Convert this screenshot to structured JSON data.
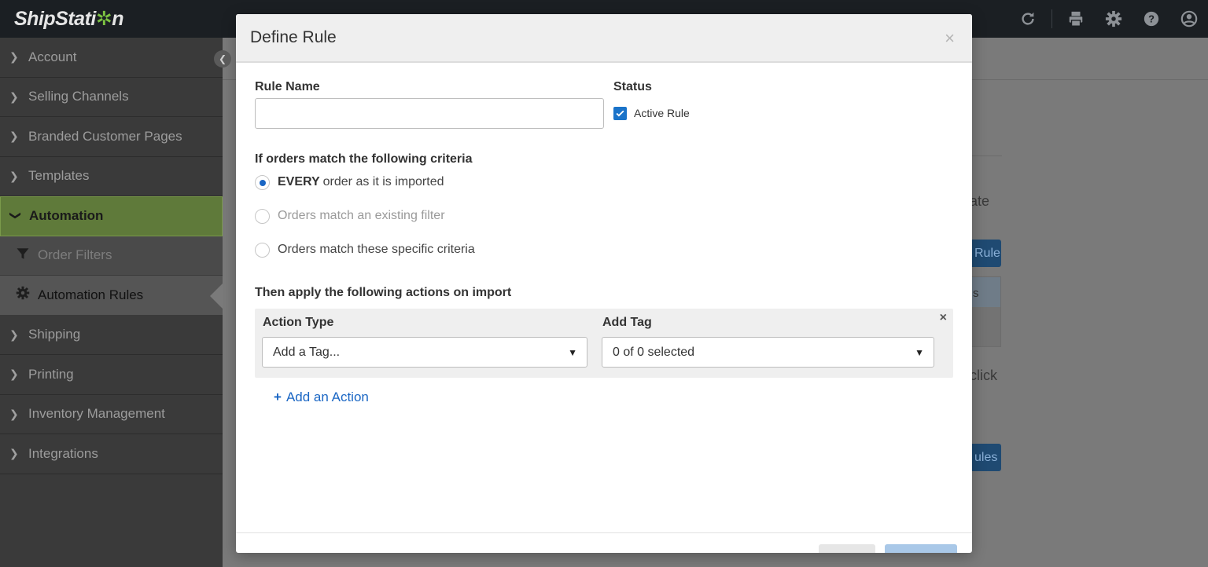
{
  "app": {
    "logo_left": "ShipStati",
    "logo_gear": "✲",
    "logo_right": "n"
  },
  "topbar": {
    "icons": [
      "refresh-icon",
      "printer-icon",
      "gear-icon",
      "help-icon",
      "user-icon"
    ]
  },
  "sidebar": {
    "items": [
      {
        "label": "Account"
      },
      {
        "label": "Selling Channels"
      },
      {
        "label": "Branded Customer Pages"
      },
      {
        "label": "Templates"
      },
      {
        "label": "Automation"
      },
      {
        "label": "Order Filters"
      },
      {
        "label": "Automation Rules"
      },
      {
        "label": "Shipping"
      },
      {
        "label": "Printing"
      },
      {
        "label": "Inventory Management"
      },
      {
        "label": "Integrations"
      }
    ]
  },
  "background": {
    "text1": "ate",
    "button1": "Rule",
    "col": "s",
    "text2": "click",
    "button2": "ules"
  },
  "modal": {
    "title": "Define Rule",
    "close": "×",
    "rule_name_label": "Rule Name",
    "rule_name_value": "",
    "status_label": "Status",
    "active_rule_label": "Active Rule",
    "active_rule_checked": true,
    "criteria_label": "If orders match the following criteria",
    "criteria_options": [
      {
        "bold": "EVERY",
        "text": "order as it is imported",
        "selected": true,
        "disabled": false
      },
      {
        "bold": "",
        "text": "Orders match an existing filter",
        "selected": false,
        "disabled": true
      },
      {
        "bold": "",
        "text": "Orders match these specific criteria",
        "selected": false,
        "disabled": false
      }
    ],
    "actions_label": "Then apply the following actions on import",
    "action_panel": {
      "close": "×",
      "action_type_label": "Action Type",
      "action_type_value": "Add a Tag...",
      "add_tag_label": "Add Tag",
      "add_tag_value": "0 of 0 selected"
    },
    "add_action_plus": "+",
    "add_action_label": "Add an Action"
  },
  "colors": {
    "accent": "#1a66c4",
    "sidebar_active": "#5f7a3a",
    "topbar": "#1b1f23"
  }
}
